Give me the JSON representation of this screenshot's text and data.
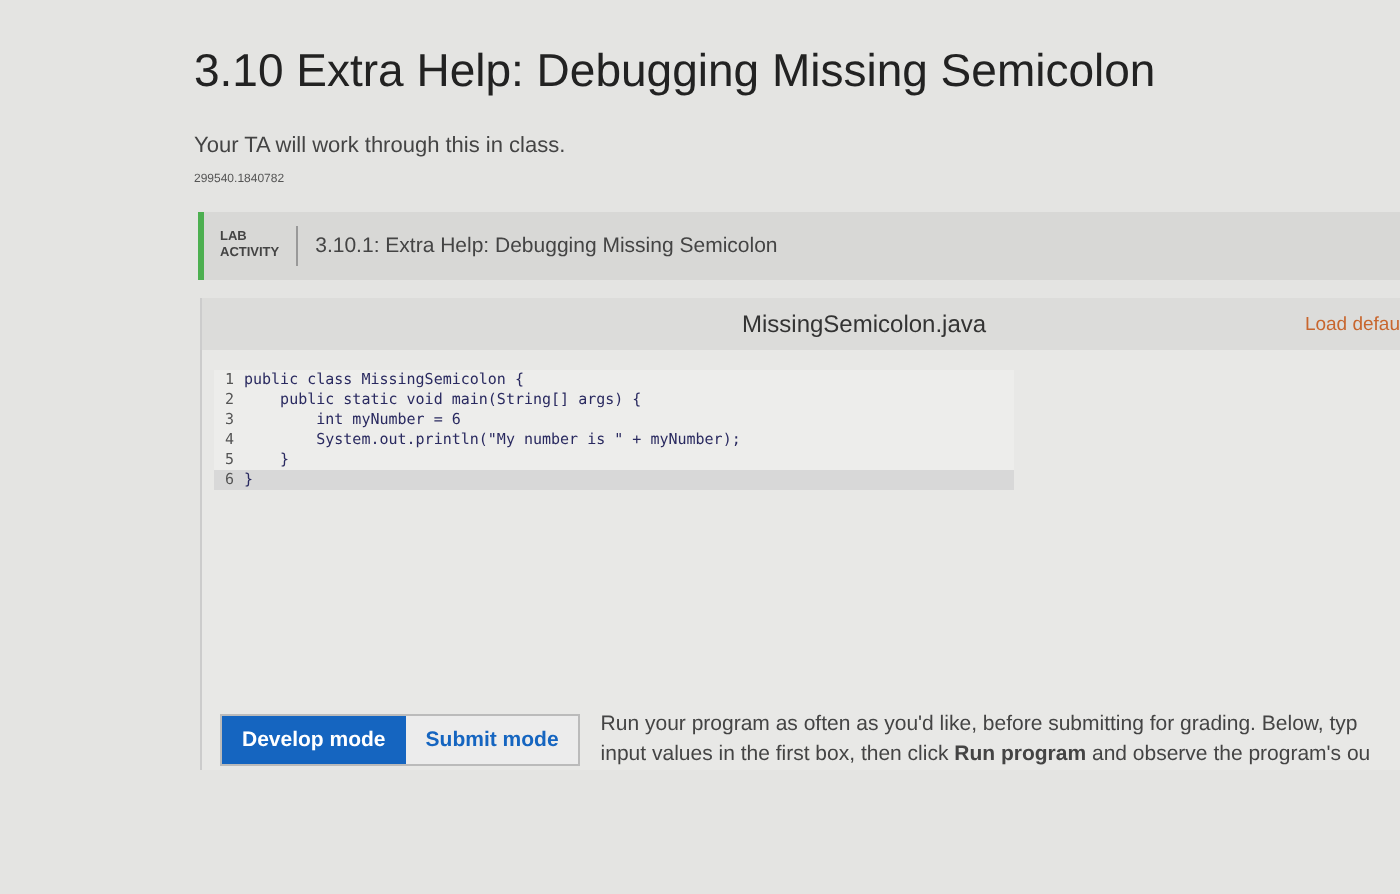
{
  "title": "3.10 Extra Help: Debugging Missing Semicolon",
  "description": "Your TA will work through this in class.",
  "id_code": "299540.1840782",
  "activity": {
    "label_lines": [
      "LAB",
      "ACTIVITY"
    ],
    "title": "3.10.1: Extra Help: Debugging Missing Semicolon"
  },
  "editor": {
    "filename": "MissingSemicolon.java",
    "load_default": "Load defau",
    "lines": [
      {
        "number": "1",
        "code": "public class MissingSemicolon {"
      },
      {
        "number": "2",
        "code": "    public static void main(String[] args) {"
      },
      {
        "number": "3",
        "code": "        int myNumber = 6"
      },
      {
        "number": "4",
        "code": "        System.out.println(\"My number is \" + myNumber);"
      },
      {
        "number": "5",
        "code": "    }"
      },
      {
        "number": "6",
        "code": "}"
      }
    ]
  },
  "modes": [
    {
      "label": "Develop mode",
      "selected": true
    },
    {
      "label": "Submit mode",
      "selected": false
    }
  ],
  "instructions": [
    "Run your program as often as you'd like, before submitting for grading. Below, typ",
    "input values in the first box, then click **Run program** and observe the program's ou"
  ]
}
